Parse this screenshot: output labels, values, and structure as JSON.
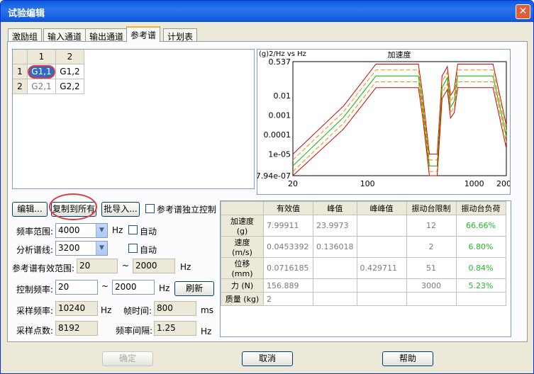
{
  "window": {
    "title": "试验编辑",
    "close": "✕"
  },
  "tabs": [
    "激励组",
    "输入通道",
    "输出通道",
    "参考谱",
    "计划表"
  ],
  "grid": {
    "col_headers": [
      "1",
      "2"
    ],
    "row_headers": [
      "1",
      "2"
    ],
    "cells": [
      [
        "G1,1",
        "G1,2"
      ],
      [
        "G2,1",
        "G2,2"
      ]
    ]
  },
  "chart": {
    "ylabel": "(g)2/Hz vs Hz",
    "title": "加速度"
  },
  "chart_data": {
    "type": "line",
    "title": "加速度",
    "ylabel": "(g)2/Hz vs Hz",
    "xlabel": "",
    "x_scale": "log",
    "y_scale": "log",
    "xlim": [
      20,
      2000
    ],
    "ylim": [
      7.94e-07,
      0.537
    ],
    "x_ticks": [
      "20",
      "100",
      "1000",
      "2000"
    ],
    "y_ticks": [
      "0.537",
      "0.01",
      "0.001",
      "0.0001",
      "1e-05",
      "7.94e-07"
    ],
    "series": [
      {
        "color": "#d00000",
        "x": [
          20,
          60,
          120,
          300,
          330,
          380,
          450,
          500,
          560,
          600,
          650,
          700,
          900,
          1500,
          2000
        ],
        "y": [
          1e-05,
          0.003,
          0.4,
          0.4,
          0.01,
          1e-05,
          1e-05,
          0.1,
          0.3,
          0.01,
          0.02,
          0.4,
          0.4,
          0.4,
          0.0003
        ]
      },
      {
        "color": "#f08c00",
        "x": [
          20,
          60,
          120,
          300,
          330,
          380,
          450,
          500,
          560,
          600,
          650,
          700,
          900,
          1500,
          2000
        ],
        "y": [
          5e-06,
          0.0015,
          0.2,
          0.2,
          0.005,
          5e-06,
          5e-06,
          0.05,
          0.15,
          0.005,
          0.01,
          0.2,
          0.2,
          0.2,
          0.00015
        ]
      },
      {
        "color": "#00b000",
        "x": [
          20,
          60,
          120,
          300,
          330,
          380,
          450,
          500,
          560,
          600,
          650,
          700,
          900,
          1500,
          2000
        ],
        "y": [
          2.5e-06,
          0.0008,
          0.1,
          0.1,
          0.0025,
          2.5e-06,
          2.5e-06,
          0.025,
          0.08,
          0.0025,
          0.005,
          0.1,
          0.1,
          0.1,
          8e-05
        ]
      },
      {
        "color": "#f08c00",
        "x": [
          20,
          60,
          120,
          300,
          330,
          380,
          450,
          500,
          560,
          600,
          650,
          700,
          900,
          1500,
          2000
        ],
        "y": [
          1.3e-06,
          0.0004,
          0.05,
          0.05,
          0.0013,
          1.3e-06,
          1.3e-06,
          0.013,
          0.04,
          0.0013,
          0.0025,
          0.05,
          0.05,
          0.05,
          4e-05
        ]
      },
      {
        "color": "#d00000",
        "x": [
          20,
          60,
          120,
          300,
          330,
          380,
          450,
          500,
          560,
          600,
          650,
          700,
          900,
          1500,
          2000
        ],
        "y": [
          7e-07,
          0.0002,
          0.025,
          0.025,
          0.0007,
          7e-07,
          7e-07,
          0.007,
          0.02,
          0.0007,
          0.0013,
          0.025,
          0.025,
          0.025,
          2e-05
        ]
      }
    ]
  },
  "buttons": {
    "edit": "编辑...",
    "copy_all": "复制到所有",
    "batch_import": "批导入...",
    "refresh": "刷新",
    "ok": "确定",
    "cancel": "取消",
    "help": "帮助"
  },
  "independent_control": "参考谱独立控制",
  "form": {
    "freq_range_label": "频率范围:",
    "freq_range_value": "4000",
    "hz": "Hz",
    "auto": "自动",
    "analysis_lines_label": "分析谱线:",
    "analysis_lines_value": "3200",
    "valid_range_label": "参考谱有效范围:",
    "valid_from": "20",
    "tilde": "~",
    "valid_to": "2000",
    "control_freq_label": "控制频率:",
    "control_from": "20",
    "control_to": "2000",
    "sample_rate_label": "采样频率:",
    "sample_rate": "10240",
    "frame_time_label": "帧时间:",
    "frame_time": "800",
    "ms": "ms",
    "sample_points_label": "采样点数:",
    "sample_points": "8192",
    "freq_interval_label": "频率间隔:",
    "freq_interval": "1.25"
  },
  "summary": {
    "headers": [
      "",
      "有效值",
      "峰值",
      "峰峰值",
      "振动台限制",
      "振动台负荷"
    ],
    "rows": [
      [
        "加速度 (g)",
        "7.99911",
        "23.9973",
        "",
        "12",
        "66.66%"
      ],
      [
        "速度 (m/s)",
        "0.0453392",
        "0.136018",
        "",
        "2",
        "6.80%"
      ],
      [
        "位移 (mm)",
        "0.0716185",
        "",
        "0.429711",
        "51",
        "0.84%"
      ],
      [
        "力 (N)",
        "156.889",
        "",
        "",
        "3000",
        "5.23%"
      ],
      [
        "质量 (kg)",
        "2",
        "",
        "",
        "",
        ""
      ]
    ]
  }
}
